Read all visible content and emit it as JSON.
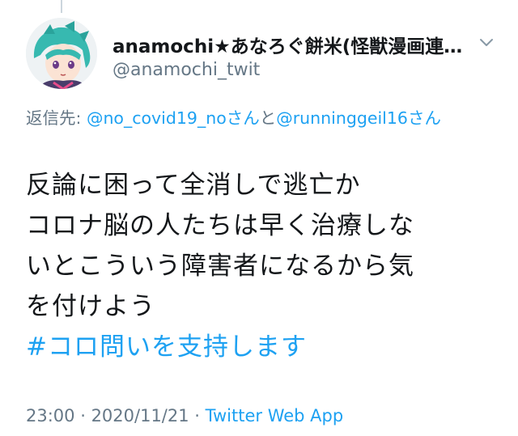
{
  "tweet": {
    "author": {
      "display_name": "anamochi★あなろぐ餅米(怪獣漫画連…",
      "handle": "@anamochi_twit",
      "avatar_icon": "avatar-image"
    },
    "reply_to": {
      "prefix": "返信先: ",
      "mention1": "@no_covid19_noさん",
      "joiner": "と",
      "mention2": "@runninggeil16さん"
    },
    "text_lines": [
      "反論に困って全消しで逃亡か",
      "コロナ脳の人たちは早く治療しな",
      "いとこういう障害者になるから気",
      "を付けよう"
    ],
    "hashtag": "#コロ問いを支持します",
    "time": "23:00",
    "separator": " · ",
    "date": "2020/11/21",
    "separator2": " · ",
    "source": "Twitter Web App"
  },
  "colors": {
    "link": "#1da1f2",
    "secondary_text": "#657786",
    "primary_text": "#14171a"
  }
}
